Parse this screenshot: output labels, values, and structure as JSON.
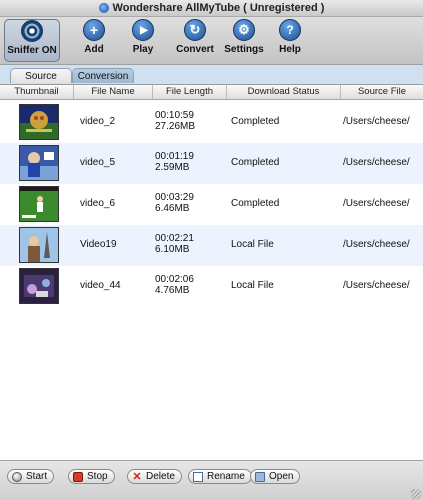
{
  "window": {
    "title": "Wondershare AllMyTube ( Unregistered )"
  },
  "toolbar": {
    "sniffer_label": "Sniffer ON",
    "add_label": "Add",
    "play_label": "Play",
    "convert_label": "Convert",
    "settings_label": "Settings",
    "help_label": "Help"
  },
  "tabs": {
    "source": "Source",
    "conversion": "Conversion",
    "active": "Source"
  },
  "table": {
    "columns": [
      "Thumbnail",
      "File Name",
      "File Length",
      "Download Status",
      "Source File"
    ],
    "rows": [
      {
        "name": "video_2",
        "duration": "00:10:59",
        "size": "27.26MB",
        "status": "Completed",
        "source": "/Users/cheese/"
      },
      {
        "name": "video_5",
        "duration": "00:01:19",
        "size": "2.59MB",
        "status": "Completed",
        "source": "/Users/cheese/"
      },
      {
        "name": "video_6",
        "duration": "00:03:29",
        "size": "6.46MB",
        "status": "Completed",
        "source": "/Users/cheese/"
      },
      {
        "name": "Video19",
        "duration": "00:02:21",
        "size": "6.10MB",
        "status": "Local File",
        "source": "/Users/cheese/"
      },
      {
        "name": "video_44",
        "duration": "00:02:06",
        "size": "4.76MB",
        "status": "Local File",
        "source": "/Users/cheese/"
      }
    ]
  },
  "bottom": {
    "start_label": "Start",
    "stop_label": "Stop",
    "delete_label": "Delete",
    "rename_label": "Rename",
    "open_label": "Open"
  },
  "colors": {
    "row_alt": "#edf3fe",
    "tab_active": "#e2e2e2",
    "tab_inactive": "#9db8d1"
  }
}
